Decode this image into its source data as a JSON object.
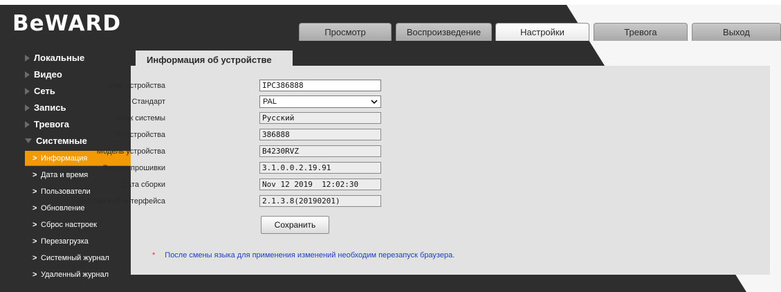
{
  "brand": {
    "logo_text": "BeWARD"
  },
  "header": {
    "tabs": [
      {
        "label": "Просмотр",
        "active": false
      },
      {
        "label": "Воспроизведение",
        "active": false
      },
      {
        "label": "Настройки",
        "active": true
      },
      {
        "label": "Тревога",
        "active": false
      },
      {
        "label": "Выход",
        "active": false
      }
    ]
  },
  "sidebar": {
    "sections": [
      {
        "label": "Локальные",
        "expanded": false
      },
      {
        "label": "Видео",
        "expanded": false
      },
      {
        "label": "Сеть",
        "expanded": false
      },
      {
        "label": "Запись",
        "expanded": false
      },
      {
        "label": "Тревога",
        "expanded": false
      },
      {
        "label": "Системные",
        "expanded": true
      }
    ],
    "sub_items": [
      {
        "label": "Информация",
        "active": true
      },
      {
        "label": "Дата и время",
        "active": false
      },
      {
        "label": "Пользователи",
        "active": false
      },
      {
        "label": "Обновление",
        "active": false
      },
      {
        "label": "Сброс настроек",
        "active": false
      },
      {
        "label": "Перезагрузка",
        "active": false
      },
      {
        "label": "Системный журнал",
        "active": false
      },
      {
        "label": "Удаленный журнал",
        "active": false
      }
    ],
    "sub_chevron": ">"
  },
  "page": {
    "title": "Информация об устройстве"
  },
  "form": {
    "fields": [
      {
        "label": "Имя устройства",
        "value": "IPC386888",
        "type": "text",
        "readonly": false
      },
      {
        "label": "Стандарт",
        "value": "PAL",
        "type": "select",
        "readonly": false
      },
      {
        "label": "Язык системы",
        "value": "Русский",
        "type": "text",
        "readonly": true
      },
      {
        "label": "ID устройства",
        "value": "386888",
        "type": "text",
        "readonly": true
      },
      {
        "label": "Модель устройства",
        "value": "B4230RVZ",
        "type": "text",
        "readonly": true
      },
      {
        "label": "Версия прошивки",
        "value": "3.1.0.0.2.19.91",
        "type": "text",
        "readonly": true
      },
      {
        "label": "Дата сборки",
        "value": "Nov 12 2019  12:02:30",
        "type": "text",
        "readonly": true
      },
      {
        "label": "Версия веб-интерфейса",
        "value": "2.1.3.8(20190201)",
        "type": "text",
        "readonly": true
      }
    ],
    "save_label": "Сохранить",
    "note_marker": "*",
    "note_text": "После смены языка для применения изменений необходим перезапуск браузера."
  },
  "colors": {
    "background": "#2e2e2e",
    "panel": "#e2e2e2",
    "accent": "#f29a05",
    "note": "#1f3fbf",
    "marker": "#e03030"
  }
}
